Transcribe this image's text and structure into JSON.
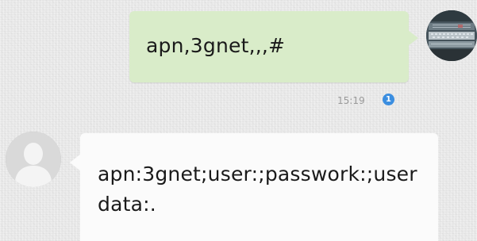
{
  "conversation": {
    "outgoing": {
      "text": "apn,3gnet,,,#",
      "timestamp": "15:19",
      "status_badge": "1",
      "bubble_color": "#d9ecc9"
    },
    "incoming": {
      "text": "apn:3gnet;user:;passwork:;userdata:.",
      "bubble_color": "#fbfbfb"
    }
  },
  "icons": {
    "outgoing_avatar": "contact-photo",
    "incoming_avatar": "default-person-silhouette",
    "status": "info-badge"
  },
  "colors": {
    "badge": "#3b8ee0",
    "timestamp": "#9a9a9a"
  }
}
